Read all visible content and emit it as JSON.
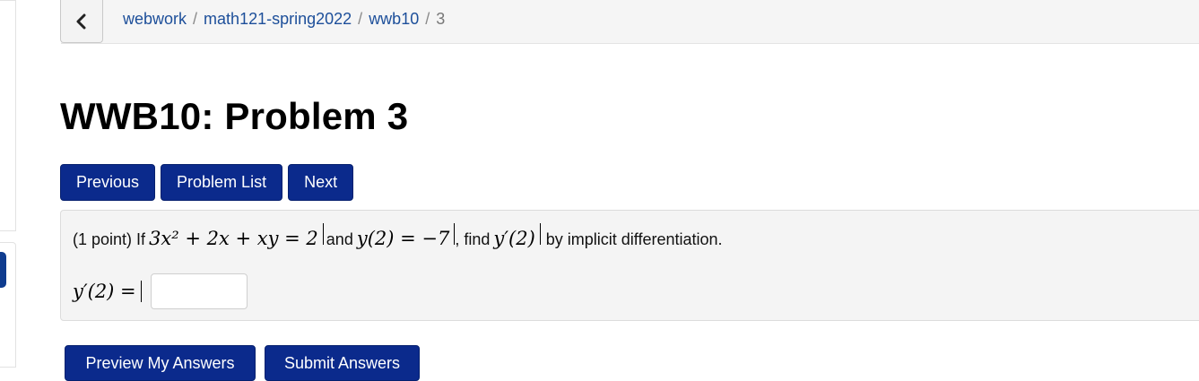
{
  "breadcrumb": {
    "items": [
      "webwork",
      "math121-spring2022",
      "wwb10"
    ],
    "current": "3",
    "separator": "/"
  },
  "back_button": {
    "icon": "chevron-left-icon"
  },
  "page": {
    "title": "WWB10: Problem 3"
  },
  "nav_buttons": {
    "previous": "Previous",
    "problem_list": "Problem List",
    "next": "Next"
  },
  "problem": {
    "points": "(1 point)",
    "text_if": "If",
    "equation": "3x² + 2x + xy = 2",
    "text_and": "and",
    "initial_condition": "y(2) = −7",
    "text_find": ", find",
    "target": "y′(2)",
    "text_method": "by implicit differentiation."
  },
  "answer": {
    "label": "y′(2) =",
    "value": ""
  },
  "actions": {
    "preview": "Preview My Answers",
    "submit": "Submit Answers"
  },
  "colors": {
    "primary_button": "#0b2a8c",
    "link": "#1d4f9a",
    "problem_bg": "#f4f4f4"
  }
}
